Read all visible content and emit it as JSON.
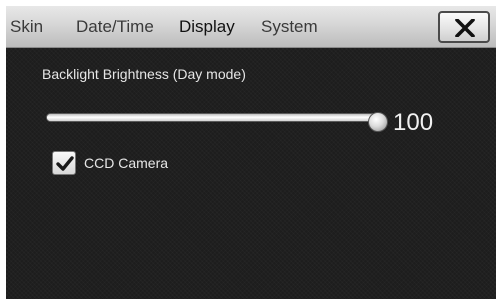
{
  "tabs": {
    "skin": "Skin",
    "datetime": "Date/Time",
    "display": "Display",
    "system": "System",
    "active": "display"
  },
  "close_icon": "close-icon",
  "display": {
    "brightness": {
      "label": "Backlight Brightness (Day mode)",
      "value": 100,
      "value_text": "100",
      "max": 100
    },
    "camera": {
      "label": "CCD Camera",
      "checked": true,
      "icon": "checkmark-icon"
    }
  },
  "colors": {
    "screen_bg": "#1d1d1d",
    "tabbar_bg": "#d6d6d6",
    "text_light": "#e6e6e6"
  }
}
